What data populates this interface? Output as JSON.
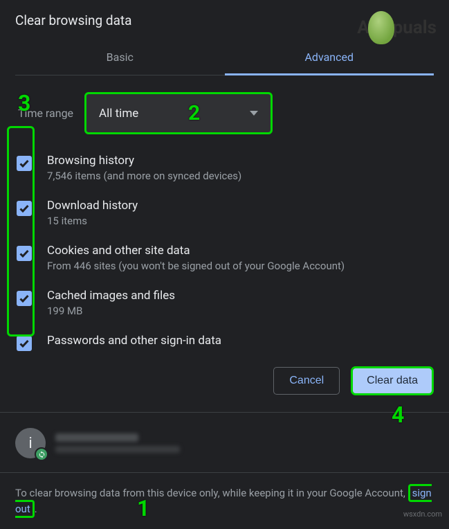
{
  "title": "Clear browsing data",
  "logo_text_left": "A",
  "logo_text_right": "puals",
  "tabs": {
    "basic": "Basic",
    "advanced": "Advanced"
  },
  "time_range": {
    "label": "Time range",
    "value": "All time"
  },
  "options": {
    "browsing": {
      "title": "Browsing history",
      "desc": "7,546 items (and more on synced devices)"
    },
    "download": {
      "title": "Download history",
      "desc": "15 items"
    },
    "cookies": {
      "title": "Cookies and other site data",
      "desc": "From 446 sites (you won't be signed out of your Google Account)"
    },
    "cache": {
      "title": "Cached images and files",
      "desc": "199 MB"
    },
    "passwords": {
      "title": "Passwords and other sign-in data",
      "desc": ""
    }
  },
  "buttons": {
    "cancel": "Cancel",
    "clear": "Clear data"
  },
  "avatar_initial": "i",
  "bottom": {
    "pre": "To clear browsing data from this device only, while keeping it in your Google Account, ",
    "link": "sign out",
    "post": "."
  },
  "annotations": {
    "a1": "1",
    "a2": "2",
    "a3": "3",
    "a4": "4"
  },
  "watermark": "wsxdn.com"
}
